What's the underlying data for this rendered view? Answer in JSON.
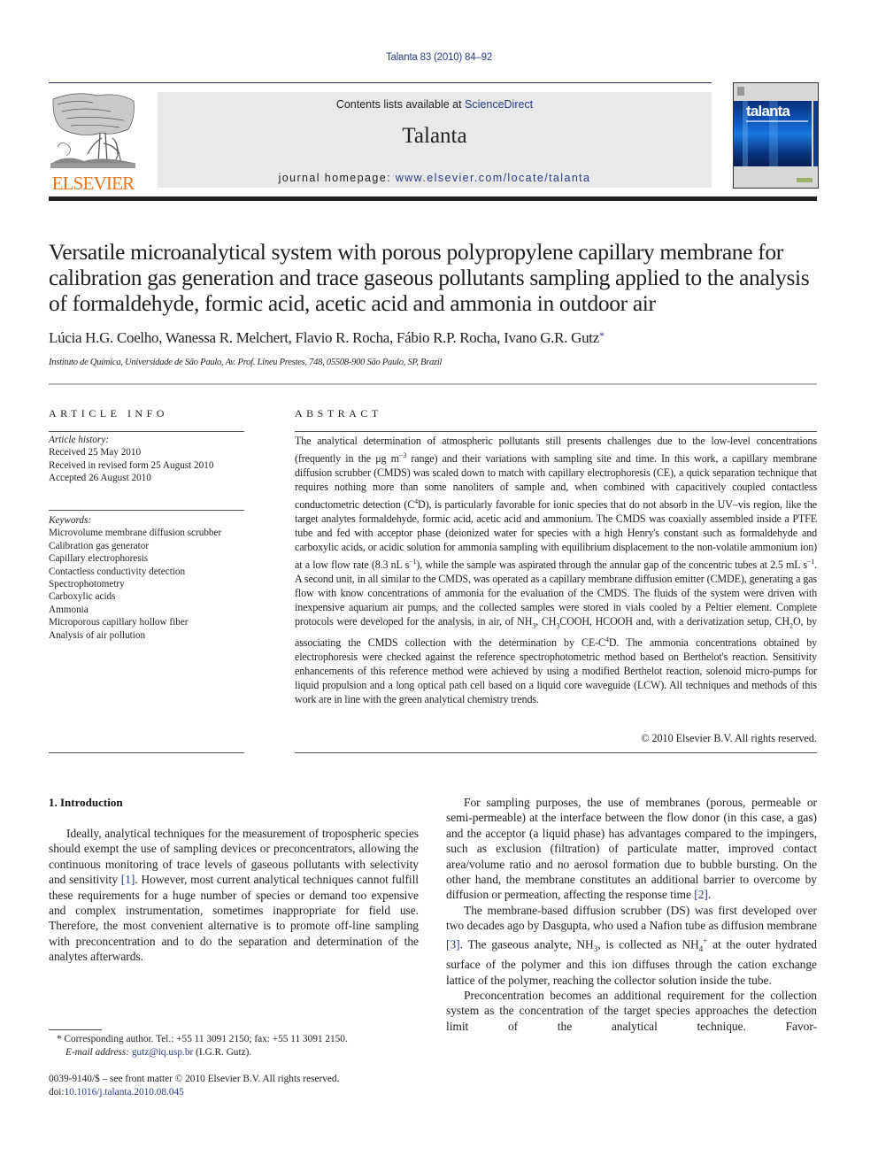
{
  "header": {
    "citation": "Talanta 83 (2010) 84–92",
    "contents_prefix": "Contents lists available at ",
    "contents_link": "ScienceDirect",
    "journal_name": "Talanta",
    "homepage_prefix": "journal homepage: ",
    "homepage_link": "www.elsevier.com/locate/talanta",
    "publisher_logo_text": "ELSEVIER",
    "cover_title": "talanta",
    "colors": {
      "link": "#2a3a8a",
      "elsevier_orange": "#e8741c",
      "banner_bg": "#e9e9e9"
    }
  },
  "article": {
    "title": "Versatile microanalytical system with porous polypropylene capillary membrane for calibration gas generation and trace gaseous pollutants sampling applied to the analysis of formaldehyde, formic acid, acetic acid and ammonia in outdoor air",
    "authors": "Lúcia H.G. Coelho, Wanessa R. Melchert, Flavio R. Rocha, Fábio R.P. Rocha, Ivano G.R. Gutz",
    "corresponding_marker": "*",
    "affiliation": "Instituto de Química, Universidade de São Paulo, Av. Prof. Lineu Prestes, 748, 05508-900 São Paulo, SP, Brazil"
  },
  "article_info": {
    "heading": "ARTICLE INFO",
    "history_label": "Article history:",
    "history": [
      "Received 25 May 2010",
      "Received in revised form 25 August 2010",
      "Accepted 26 August 2010"
    ],
    "keywords_label": "Keywords:",
    "keywords": [
      "Microvolume membrane diffusion scrubber",
      "Calibration gas generator",
      "Capillary electrophoresis",
      "Contactless conductivity detection",
      "Spectrophotometry",
      "Carboxylic acids",
      "Ammonia",
      "Microporous capillary hollow fiber",
      "Analysis of air pollution"
    ]
  },
  "abstract": {
    "heading": "ABSTRACT",
    "parts": [
      "The analytical determination of atmospheric pollutants still presents challenges due to the low-level concentrations (frequently in the μg m",
      "−3",
      " range) and their variations with sampling site and time. In this work, a capillary membrane diffusion scrubber (CMDS) was scaled down to match with capillary electrophoresis (CE), a quick separation technique that requires nothing more than some nanoliters of sample and, when combined with capacitively coupled contactless conductometric detection (C",
      "4",
      "D), is particularly favorable for ionic species that do not absorb in the UV–vis region, like the target analytes formaldehyde, formic acid, acetic acid and ammonium. The CMDS was coaxially assembled inside a PTFE tube and fed with acceptor phase (deionized water for species with a high Henry's constant such as formaldehyde and carboxylic acids, or acidic solution for ammonia sampling with equilibrium displacement to the non-volatile ammonium ion) at a low flow rate (8.3 nL s",
      "−1",
      "), while the sample was aspirated through the annular gap of the concentric tubes at 2.5 mL s",
      "−1",
      ". A second unit, in all similar to the CMDS, was operated as a capillary membrane diffusion emitter (CMDE), generating a gas flow with know concentrations of ammonia for the evaluation of the CMDS. The fluids of the system were driven with inexpensive aquarium air pumps, and the collected samples were stored in vials cooled by a Peltier element. Complete protocols were developed for the analysis, in air, of NH",
      "3",
      ", CH",
      "3",
      "COOH, HCOOH and, with a derivatization setup, CH",
      "2",
      "O, by associating the CMDS collection with the determination by CE-C",
      "4",
      "D. The ammonia concentrations obtained by electrophoresis were checked against the reference spectrophotometric method based on Berthelot's reaction. Sensitivity enhancements of this reference method were achieved by using a modified Berthelot reaction, solenoid micro-pumps for liquid propulsion and a long optical path cell based on a liquid core waveguide (LCW). All techniques and methods of this work are in line with the green analytical chemistry trends."
    ],
    "copyright": "© 2010 Elsevier B.V. All rights reserved."
  },
  "body": {
    "section_heading": "1.  Introduction",
    "left": {
      "p1_a": "Ideally, analytical techniques for the measurement of tropospheric species should exempt the use of sampling devices or preconcentrators, allowing the continuous monitoring of trace levels of gaseous pollutants with selectivity and sensitivity ",
      "p1_ref": "[1]",
      "p1_b": ". However, most current analytical techniques cannot fulfill these requirements for a huge number of species or demand too expensive and complex instrumentation, sometimes inappropriate for field use. Therefore, the most convenient alternative is to promote off-line sampling with preconcentration and to do the separation and determination of the analytes afterwards."
    },
    "right": {
      "p1_a": "For sampling purposes, the use of membranes (porous, permeable or semi-permeable) at the interface between the flow donor (in this case, a gas) and the acceptor (a liquid phase) has advantages compared to the impingers, such as exclusion (filtration) of particulate matter, improved contact area/volume ratio and no aerosol formation due to bubble bursting. On the other hand, the membrane constitutes an additional barrier to overcome by diffusion or permeation, affecting the response time ",
      "p1_ref": "[2]",
      "p1_b": ".",
      "p2_a": "The membrane-based diffusion scrubber (DS) was first developed over two decades ago by Dasgupta, who used a Nafion tube as diffusion membrane ",
      "p2_ref": "[3]",
      "p2_b": ". The gaseous analyte, NH",
      "p2_sub1": "3",
      "p2_c": ", is collected as NH",
      "p2_sub2": "4",
      "p2_sup": "+",
      "p2_d": " at the outer hydrated surface of the polymer and this ion diffuses through the cation exchange lattice of the polymer, reaching the collector solution inside the tube.",
      "p3": "Preconcentration becomes an additional requirement for the collection system as the concentration of the target species approaches the detection limit of the analytical technique. Favor-"
    }
  },
  "footnote": {
    "marker": "*",
    "text": " Corresponding author. Tel.: +55 11 3091 2150; fax: +55 11 3091 2150.",
    "email_label": "E-mail address: ",
    "email": "gutz@iq.usp.br",
    "email_suffix": " (I.G.R. Gutz)."
  },
  "front_matter": {
    "issn_line": "0039-9140/$ – see front matter © 2010 Elsevier B.V. All rights reserved.",
    "doi_prefix": "doi:",
    "doi": "10.1016/j.talanta.2010.08.045"
  }
}
